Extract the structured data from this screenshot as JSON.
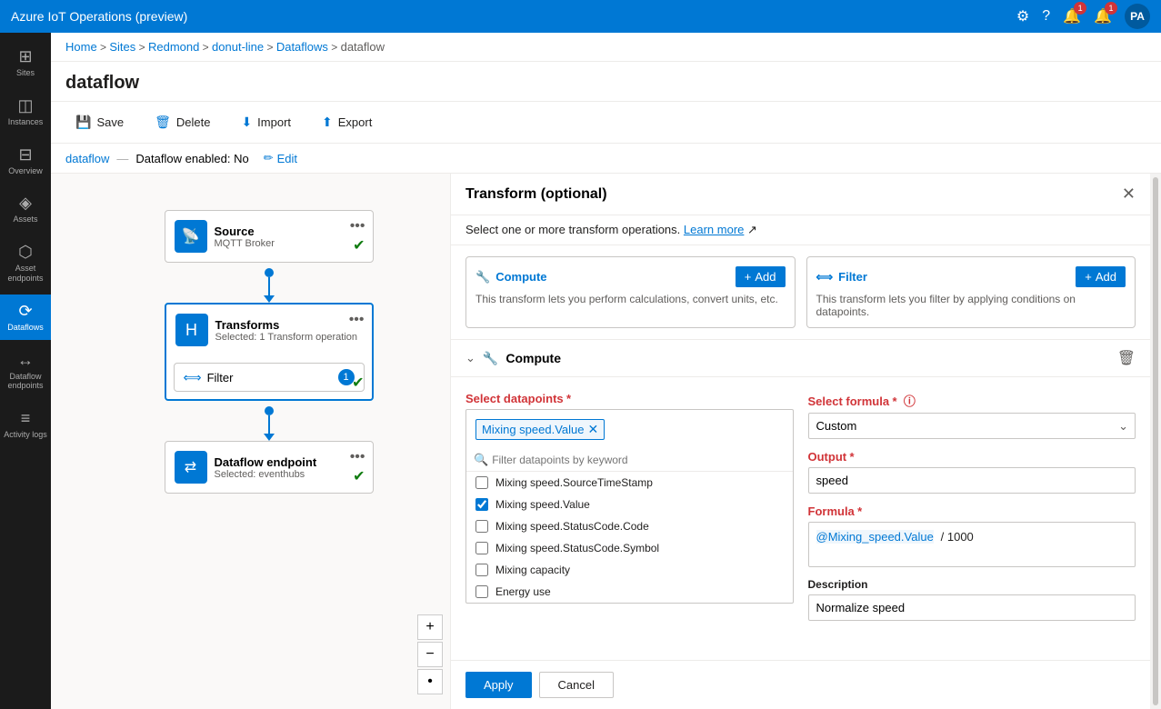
{
  "app": {
    "title": "Azure IoT Operations (preview)"
  },
  "topbar": {
    "title": "Azure IoT Operations (preview)",
    "icons": {
      "settings": "⚙",
      "help": "?",
      "notifications1": "🔔",
      "notifications2": "🔔",
      "avatar": "PA"
    },
    "badge1": "1",
    "badge2": "1"
  },
  "sidebar": {
    "items": [
      {
        "id": "sites",
        "label": "Sites",
        "icon": "⊞"
      },
      {
        "id": "instances",
        "label": "Instances",
        "icon": "◫"
      },
      {
        "id": "overview",
        "label": "Overview",
        "icon": "⊟"
      },
      {
        "id": "assets",
        "label": "Assets",
        "icon": "◈"
      },
      {
        "id": "asset-endpoints",
        "label": "Asset endpoints",
        "icon": "⬡"
      },
      {
        "id": "dataflows",
        "label": "Dataflows",
        "icon": "⟳",
        "active": true
      },
      {
        "id": "dataflow-endpoints",
        "label": "Dataflow endpoints",
        "icon": "↔"
      },
      {
        "id": "activity-logs",
        "label": "Activity logs",
        "icon": "≡"
      }
    ]
  },
  "breadcrumb": {
    "items": [
      "Home",
      "Sites",
      "Redmond",
      "donut-line",
      "Dataflows",
      "dataflow"
    ]
  },
  "page": {
    "title": "dataflow"
  },
  "toolbar": {
    "save_label": "Save",
    "delete_label": "Delete",
    "import_label": "Import",
    "export_label": "Export"
  },
  "dataflow_bar": {
    "name": "dataflow",
    "status": "Dataflow enabled: No",
    "edit_label": "Edit"
  },
  "nodes": {
    "source": {
      "title": "Source",
      "subtitle": "MQTT Broker"
    },
    "transforms": {
      "title": "Transforms",
      "subtitle": "Selected: 1 Transform operation",
      "filter_label": "Filter",
      "filter_badge": "1"
    },
    "endpoint": {
      "title": "Dataflow endpoint",
      "subtitle": "Selected: eventhubs"
    }
  },
  "panel": {
    "title": "Transform (optional)",
    "subtitle": "Select one or more transform operations.",
    "learn_more": "Learn more",
    "compute": {
      "title": "Compute",
      "add_label": "+ Add",
      "desc": "This transform lets you perform calculations, convert units, etc."
    },
    "filter": {
      "title": "Filter",
      "add_label": "+ Add",
      "desc": "This transform lets you filter by applying conditions on datapoints."
    },
    "compute_section": {
      "title": "Compute",
      "select_datapoints_label": "Select datapoints",
      "selected_tag": "Mixing speed.Value",
      "filter_placeholder": "Filter datapoints by keyword",
      "datapoints": [
        {
          "id": "dp1",
          "label": "Mixing speed.SourceTimeStamp",
          "checked": false
        },
        {
          "id": "dp2",
          "label": "Mixing speed.Value",
          "checked": true
        },
        {
          "id": "dp3",
          "label": "Mixing speed.StatusCode.Code",
          "checked": false
        },
        {
          "id": "dp4",
          "label": "Mixing speed.StatusCode.Symbol",
          "checked": false
        },
        {
          "id": "dp5",
          "label": "Mixing capacity",
          "checked": false
        },
        {
          "id": "dp6",
          "label": "Energy use",
          "checked": false
        }
      ],
      "select_formula_label": "Select formula",
      "formula_info": "ⓘ",
      "formula_options": [
        {
          "value": "Custom",
          "label": "Custom"
        }
      ],
      "formula_selected": "Custom",
      "output_label": "Output",
      "output_value": "speed",
      "formula_label": "Formula",
      "formula_value": "@Mixing_speed.Value / 1000",
      "description_label": "Description",
      "description_value": "Normalize speed"
    },
    "footer": {
      "apply_label": "Apply",
      "cancel_label": "Cancel"
    }
  },
  "zoom": {
    "plus": "+",
    "minus": "−",
    "dot": "•"
  }
}
